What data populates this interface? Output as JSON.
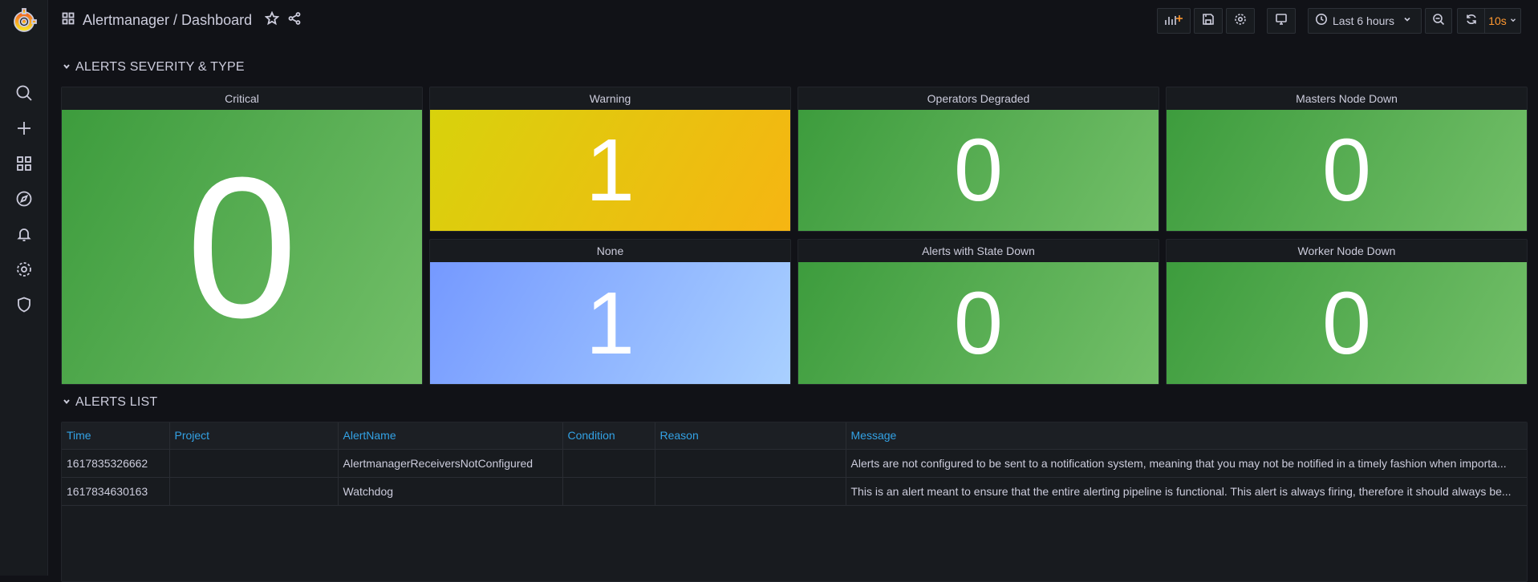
{
  "app": {
    "logo": "grafana-logo-icon"
  },
  "breadcrumb": {
    "title": "Alertmanager / Dashboard"
  },
  "toolbar": {
    "time_range": "Last 6 hours",
    "refresh_interval": "10s"
  },
  "rows": {
    "severity_title": "ALERTS SEVERITY & TYPE",
    "list_title": "ALERTS LIST"
  },
  "panels": [
    {
      "title": "Critical",
      "value": "0",
      "color": "#56a64b"
    },
    {
      "title": "Warning",
      "value": "1",
      "color": "#e0b400"
    },
    {
      "title": "Operators Degraded",
      "value": "0",
      "color": "#56a64b"
    },
    {
      "title": "Masters Node Down",
      "value": "0",
      "color": "#56a64b"
    },
    {
      "title": "None",
      "value": "1",
      "color": "#8ab8ff"
    },
    {
      "title": "Alerts with State Down",
      "value": "0",
      "color": "#56a64b"
    },
    {
      "title": "Worker Node Down",
      "value": "0",
      "color": "#56a64b"
    }
  ],
  "table": {
    "columns": [
      "Time",
      "Project",
      "AlertName",
      "Condition",
      "Reason",
      "Message"
    ],
    "rows": [
      {
        "time": "1617835326662",
        "project": "",
        "alertname": "AlertmanagerReceiversNotConfigured",
        "condition": "",
        "reason": "",
        "message": "Alerts are not configured to be sent to a notification system, meaning that you may not be notified in a timely fashion when importa..."
      },
      {
        "time": "1617834630163",
        "project": "",
        "alertname": "Watchdog",
        "condition": "",
        "reason": "",
        "message": "This is an alert meant to ensure that the entire alerting pipeline is functional. This alert is always firing, therefore it should always be..."
      }
    ]
  },
  "colors": {
    "accent": "#33a2e5",
    "refresh": "#ff9830"
  }
}
